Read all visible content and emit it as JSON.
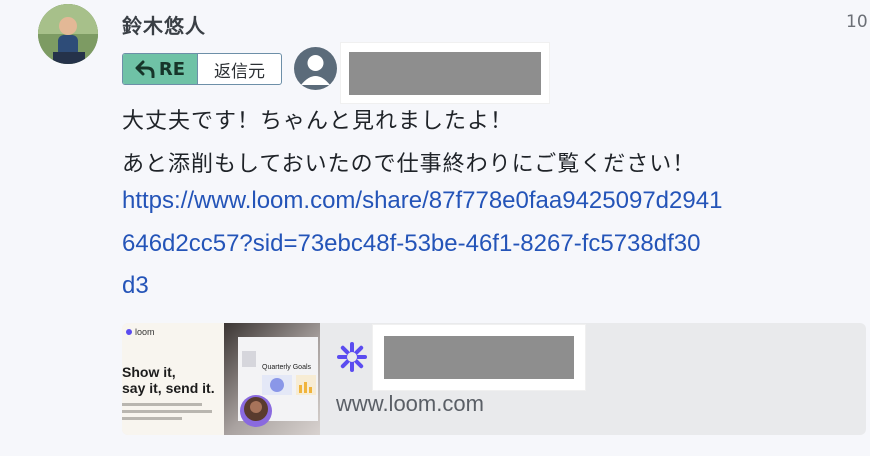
{
  "message": {
    "sender_name": "鈴木悠人",
    "timestamp": "10",
    "reply_badge": {
      "re_label": "RE",
      "source_label": "返信元"
    },
    "body_lines": [
      "大丈夫です！ちゃんと見れましたよ！",
      "あと添削もしておいたので仕事終わりにご覧ください！"
    ],
    "link_lines": [
      "https://www.loom.com/share/87f778e0faa9425097d2941",
      "646d2cc57?sid=73ebc48f-53be-46f1-8267-fc5738df30",
      "d3"
    ]
  },
  "link_preview": {
    "domain": "www.loom.com",
    "thumb_brand": "loom",
    "thumb_headline_1": "Show it,",
    "thumb_headline_2": "say it, send it.",
    "thumb_card_title": "Quarterly Goals",
    "accent_color": "#5b4cf0"
  },
  "icons": {
    "reply": "reply-arrow-icon",
    "user": "user-placeholder-icon",
    "loom": "loom-logo-icon"
  }
}
